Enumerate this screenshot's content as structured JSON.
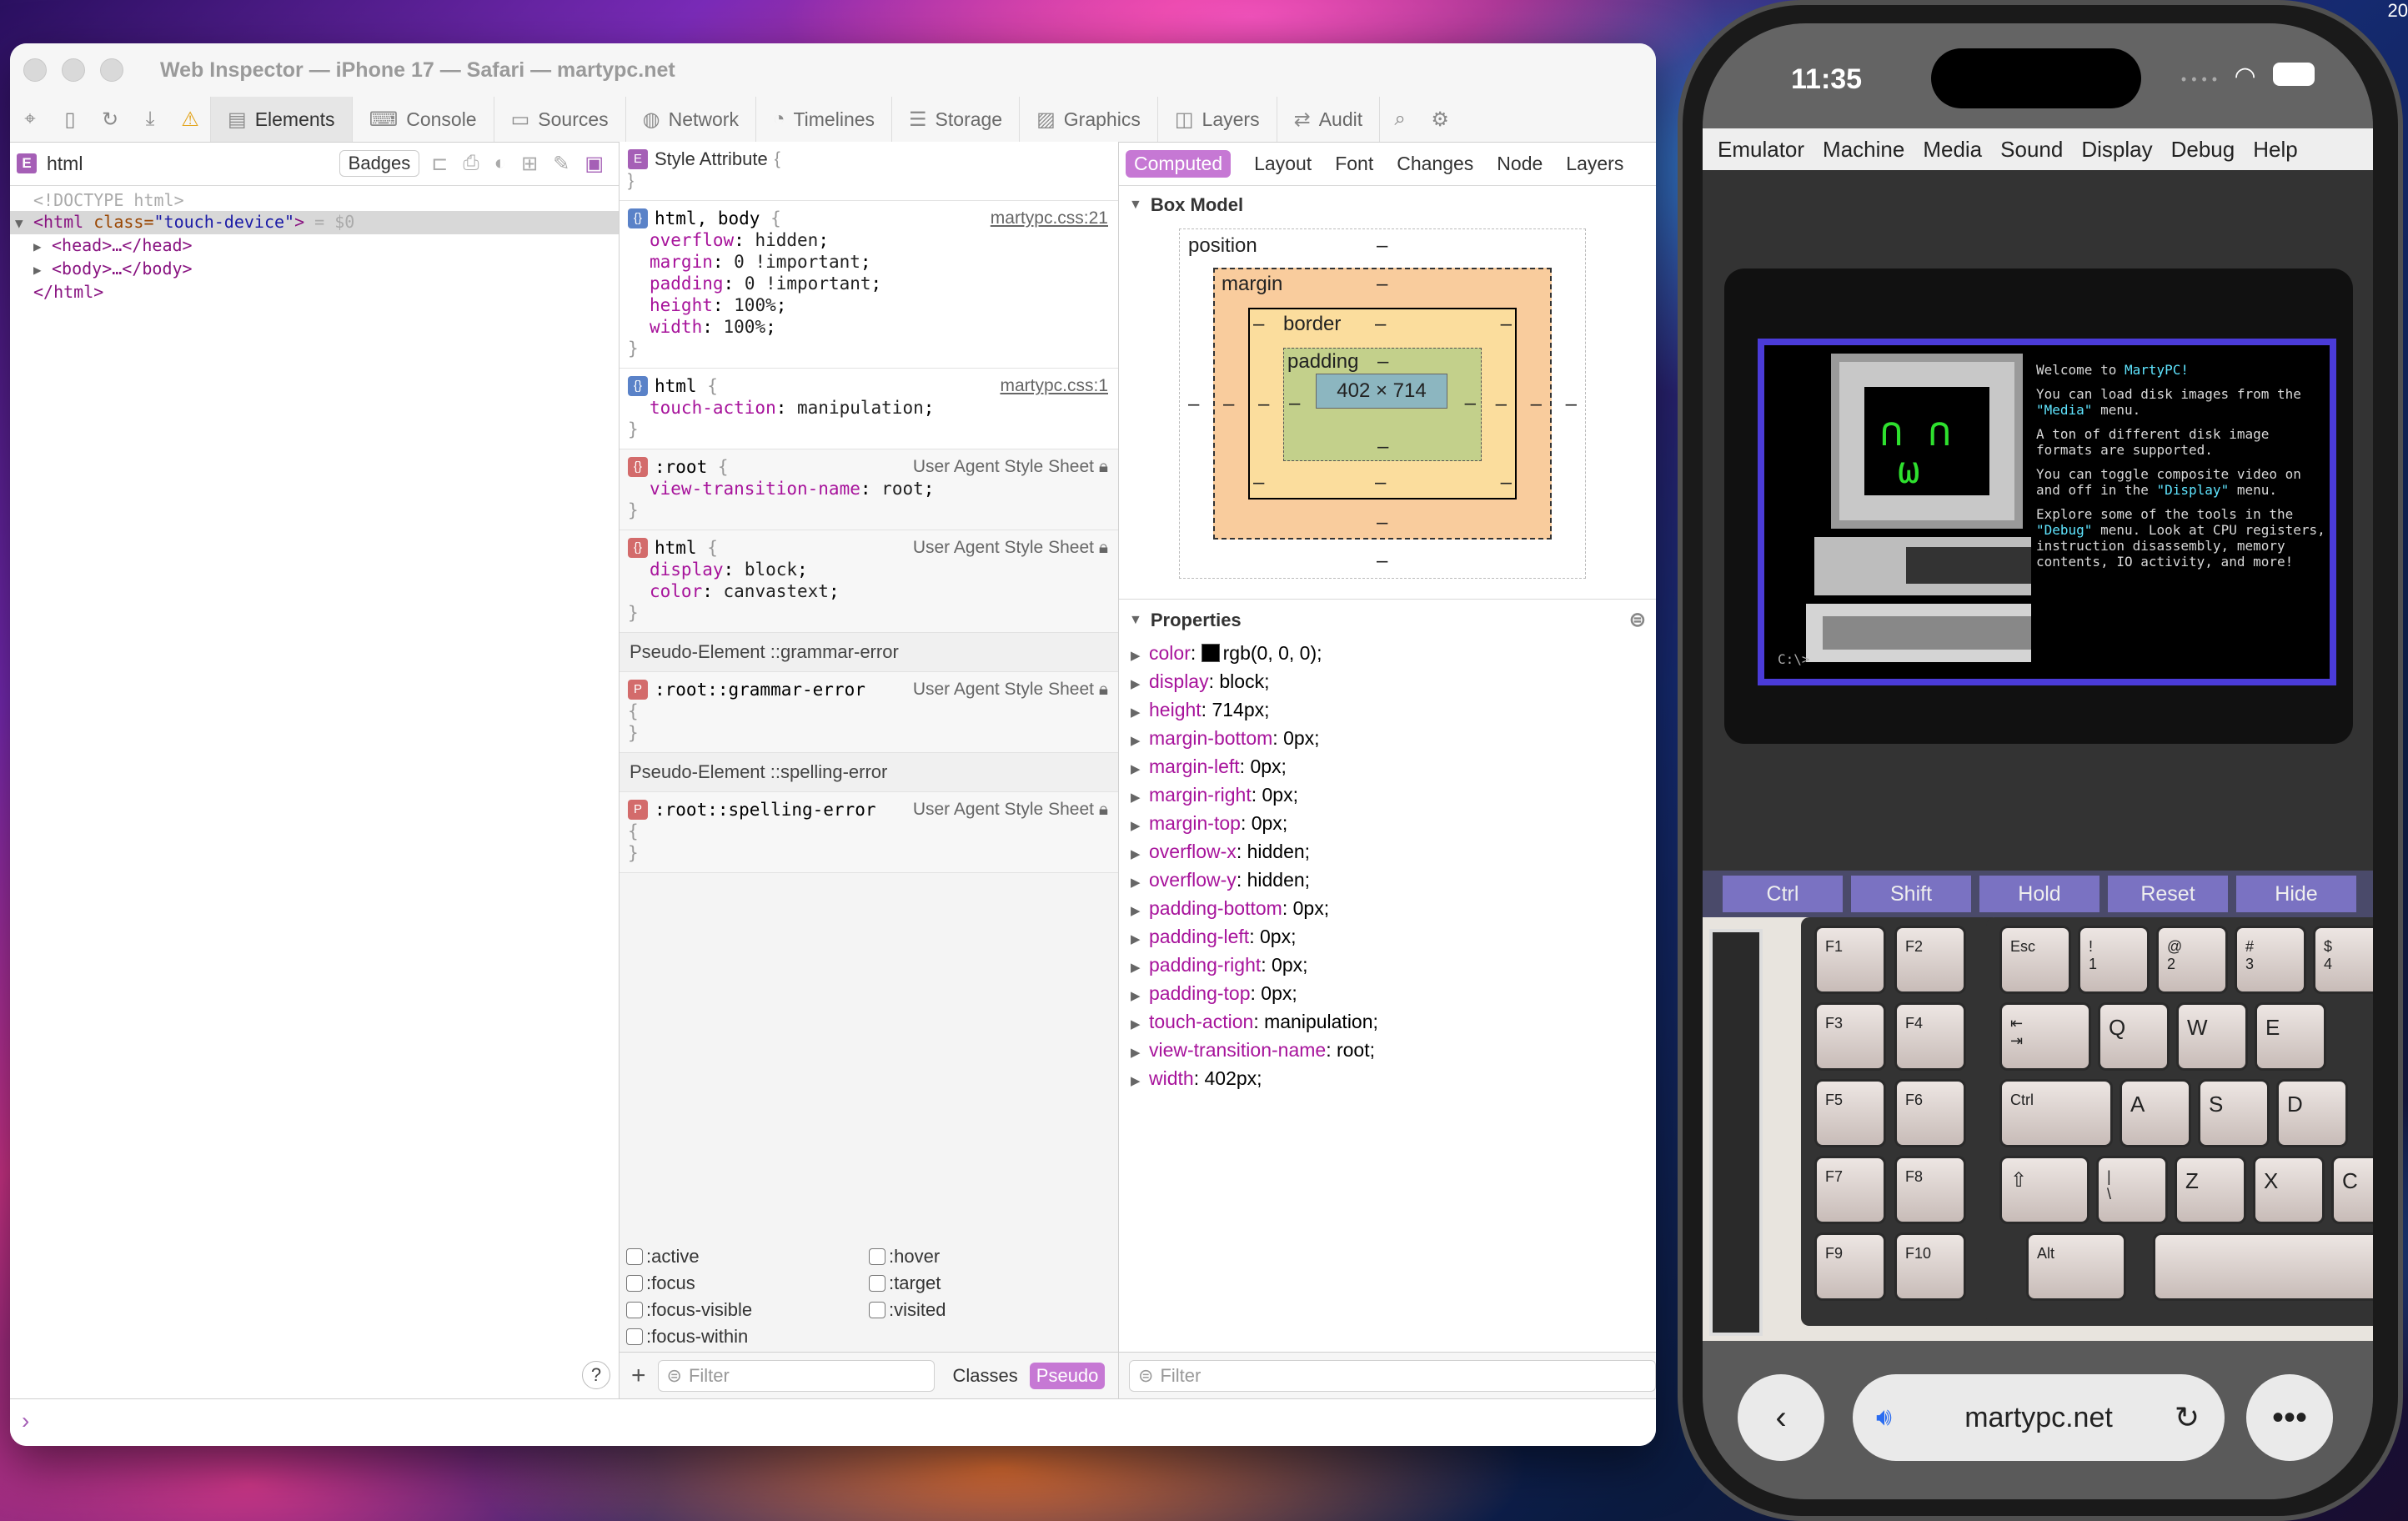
{
  "window": {
    "title": "Web Inspector — iPhone 17 — Safari — martypc.net"
  },
  "toolbar": {
    "tabs": [
      {
        "label": "Elements",
        "icon": "elements-icon"
      },
      {
        "label": "Console",
        "icon": "console-icon"
      },
      {
        "label": "Sources",
        "icon": "sources-icon"
      },
      {
        "label": "Network",
        "icon": "network-icon"
      },
      {
        "label": "Timelines",
        "icon": "timelines-icon"
      },
      {
        "label": "Storage",
        "icon": "storage-icon"
      },
      {
        "label": "Graphics",
        "icon": "graphics-icon"
      },
      {
        "label": "Layers",
        "icon": "layers-icon"
      },
      {
        "label": "Audit",
        "icon": "audit-icon"
      }
    ],
    "selected_tab": "Elements"
  },
  "dom_pane": {
    "breadcrumb_badge": "E",
    "breadcrumb": "html",
    "badges_label": "Badges",
    "lines": {
      "doctype": "<!DOCTYPE html>",
      "html_open_tag": "<html",
      "html_attr": " class=",
      "html_attr_val": "\"touch-device\"",
      "html_close_bracket": ">",
      "html_suffix": " = $0",
      "head": "<head>…</head>",
      "body": "<body>…</body>",
      "html_close": "</html>"
    },
    "help_label": "?"
  },
  "rules_pane": {
    "style_attribute_badge": "E",
    "style_attribute": "Style Attribute",
    "rules": [
      {
        "selector": "html, body",
        "source": "martypc.css:21",
        "props": [
          [
            "overflow",
            "hidden"
          ],
          [
            "margin",
            "0 !important"
          ],
          [
            "padding",
            "0 !important"
          ],
          [
            "height",
            "100%"
          ],
          [
            "width",
            "100%"
          ]
        ]
      },
      {
        "selector": "html",
        "source": "martypc.css:1",
        "props": [
          [
            "touch-action",
            "manipulation"
          ]
        ]
      },
      {
        "selector": ":root",
        "source": "User Agent Style Sheet",
        "props": [
          [
            "view-transition-name",
            "root"
          ]
        ]
      },
      {
        "selector": "html",
        "source": "User Agent Style Sheet",
        "props": [
          [
            "display",
            "block"
          ],
          [
            "color",
            "canvastext"
          ]
        ]
      }
    ],
    "pseudo_grammar_header": "Pseudo-Element ::grammar-error",
    "pseudo_grammar_badge": "P",
    "pseudo_grammar_selector": ":root::grammar-error",
    "pseudo_grammar_source": "User Agent Style Sheet",
    "pseudo_spelling_header": "Pseudo-Element ::spelling-error",
    "pseudo_spelling_badge": "P",
    "pseudo_spelling_selector": ":root::spelling-error",
    "pseudo_spelling_source": "User Agent Style Sheet",
    "pseudo_classes": [
      ":active",
      ":hover",
      ":focus",
      ":target",
      ":focus-visible",
      ":visited",
      ":focus-within"
    ],
    "filter_placeholder": "Filter",
    "classes_label": "Classes",
    "pseudo_label": "Pseudo"
  },
  "computed_pane": {
    "tabs": [
      "Computed",
      "Layout",
      "Font",
      "Changes",
      "Node",
      "Layers"
    ],
    "selected_tab": "Computed",
    "box_model_header": "Box Model",
    "box_model": {
      "position": "position",
      "margin": "margin",
      "border": "border",
      "padding": "padding",
      "content": "402 × 714",
      "dash": "–"
    },
    "properties_header": "Properties",
    "properties": [
      [
        "color",
        "rgb(0, 0, 0)"
      ],
      [
        "display",
        "block"
      ],
      [
        "height",
        "714px"
      ],
      [
        "margin-bottom",
        "0px"
      ],
      [
        "margin-left",
        "0px"
      ],
      [
        "margin-right",
        "0px"
      ],
      [
        "margin-top",
        "0px"
      ],
      [
        "overflow-x",
        "hidden"
      ],
      [
        "overflow-y",
        "hidden"
      ],
      [
        "padding-bottom",
        "0px"
      ],
      [
        "padding-left",
        "0px"
      ],
      [
        "padding-right",
        "0px"
      ],
      [
        "padding-top",
        "0px"
      ],
      [
        "touch-action",
        "manipulation"
      ],
      [
        "view-transition-name",
        "root"
      ],
      [
        "width",
        "402px"
      ]
    ],
    "filter_placeholder": "Filter"
  },
  "console": {
    "prompt": "›"
  },
  "phone": {
    "time": "11:35",
    "menu": [
      "Emulator",
      "Machine",
      "Media",
      "Sound",
      "Display",
      "Debug",
      "Help"
    ],
    "dos_lines": [
      {
        "plain": "Welcome to ",
        "hl": "MartyPC!",
        "rest": ""
      },
      {
        "plain": "You can load disk images from the ",
        "hl": "\"Media\"",
        "rest": " menu."
      },
      {
        "plain": "A ton of different disk image formats are supported.",
        "hl": "",
        "rest": ""
      },
      {
        "plain": "You can toggle composite video on and off in the ",
        "hl": "\"Display\"",
        "rest": " menu."
      },
      {
        "plain": "Explore some of the tools in the ",
        "hl": "\"Debug\"",
        "rest": " menu. Look at CPU registers, instruction disassembly, memory contents, IO activity, and more!"
      }
    ],
    "dos_prompt": "C:\\>",
    "keybar": [
      "Ctrl",
      "Shift",
      "Hold",
      "Reset",
      "Hide"
    ],
    "fkeys": [
      "F1",
      "F2",
      "F3",
      "F4",
      "F5",
      "F6",
      "F7",
      "F8",
      "F9",
      "F10"
    ],
    "url": "martypc.net",
    "edge_number": "20"
  }
}
